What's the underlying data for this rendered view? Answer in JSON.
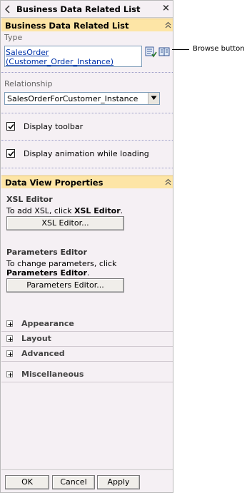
{
  "window": {
    "title": "Business Data Related List",
    "close_glyph": "×"
  },
  "section_main": {
    "title": "Business Data Related List"
  },
  "type": {
    "label": "Type",
    "line1": "SalesOrder",
    "line2": "(Customer_Order_Instance)"
  },
  "relationship": {
    "label": "Relationship",
    "selected": "SalesOrderForCustomer_Instance"
  },
  "checkboxes": {
    "toolbar": "Display toolbar",
    "animation": "Display animation while loading"
  },
  "section_dataview": {
    "title": "Data View Properties"
  },
  "xsl": {
    "title": "XSL Editor",
    "desc_prefix": "To add XSL, click ",
    "desc_bold": "XSL Editor",
    "desc_suffix": ".",
    "button": "XSL Editor..."
  },
  "params": {
    "title": "Parameters Editor",
    "desc_line1": "To change parameters, click",
    "desc_bold": "Parameters Editor",
    "desc_suffix": ".",
    "button": "Parameters Editor..."
  },
  "expanders": [
    "Appearance",
    "Layout",
    "Advanced",
    "Miscellaneous"
  ],
  "footer": {
    "ok": "OK",
    "cancel": "Cancel",
    "apply": "Apply"
  },
  "callout": {
    "text": "Browse button"
  },
  "icons": {
    "back": "back-arrow-icon",
    "close": "close-icon",
    "collapse": "collapse-up-icon",
    "check_names": "check-names-icon",
    "browse": "browse-book-icon",
    "dropdown": "chevron-down-icon",
    "expand": "plus-expand-icon"
  },
  "colors": {
    "pane_bg": "#f5f0f4",
    "section_header_bg": "#fde5a6",
    "link": "#0033aa"
  }
}
